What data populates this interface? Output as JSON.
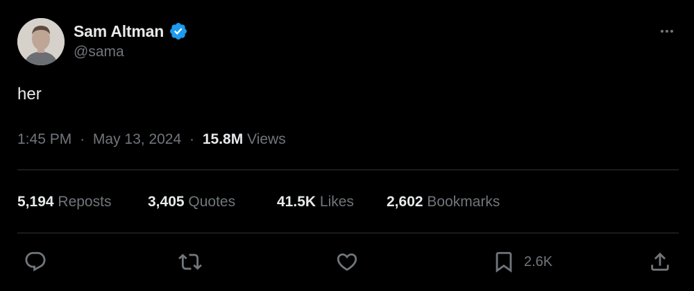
{
  "author": {
    "display_name": "Sam Altman",
    "handle": "@sama",
    "verified": true,
    "verified_color": "#1d9bf0"
  },
  "tweet": {
    "text": "her",
    "time": "1:45 PM",
    "date": "May 13, 2024",
    "separator": "·",
    "views_count": "15.8M",
    "views_label": "Views"
  },
  "stats": {
    "reposts": {
      "count": "5,194",
      "label": "Reposts"
    },
    "quotes": {
      "count": "3,405",
      "label": "Quotes"
    },
    "likes": {
      "count": "41.5K",
      "label": "Likes"
    },
    "bookmarks": {
      "count": "2,602",
      "label": "Bookmarks"
    }
  },
  "actions": {
    "bookmark_count": "2.6K"
  },
  "icons": {
    "more": "more-horizontal-icon",
    "reply": "reply-icon",
    "repost": "repost-icon",
    "like": "heart-icon",
    "bookmark": "bookmark-icon",
    "share": "share-icon"
  },
  "colors": {
    "background": "#000000",
    "primary_text": "#e7e9ea",
    "secondary_text": "#71767b",
    "divider": "#2f3336",
    "accent": "#1d9bf0"
  }
}
